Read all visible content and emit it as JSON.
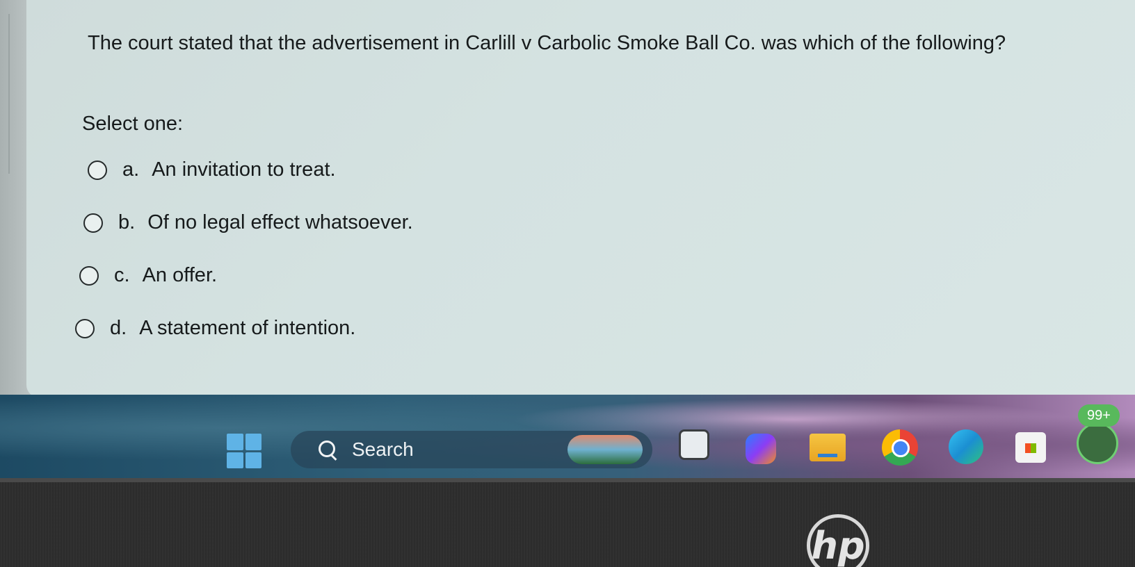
{
  "question": {
    "text": "The court stated that the advertisement in Carlill v Carbolic Smoke Ball Co. was which of the following?",
    "select_label": "Select one:",
    "options": [
      {
        "letter": "a.",
        "text": "An invitation to treat."
      },
      {
        "letter": "b.",
        "text": "Of no legal effect whatsoever."
      },
      {
        "letter": "c.",
        "text": "An offer."
      },
      {
        "letter": "d.",
        "text": "A statement of intention."
      }
    ]
  },
  "taskbar": {
    "search_label": "Search",
    "whatsapp_badge": "99+",
    "icons": [
      "windows-start-icon",
      "search-icon",
      "app-icon",
      "copilot-icon",
      "file-explorer-icon",
      "chrome-icon",
      "edge-icon",
      "microsoft-store-icon",
      "whatsapp-icon"
    ]
  },
  "bezel": {
    "logo": "hp"
  }
}
